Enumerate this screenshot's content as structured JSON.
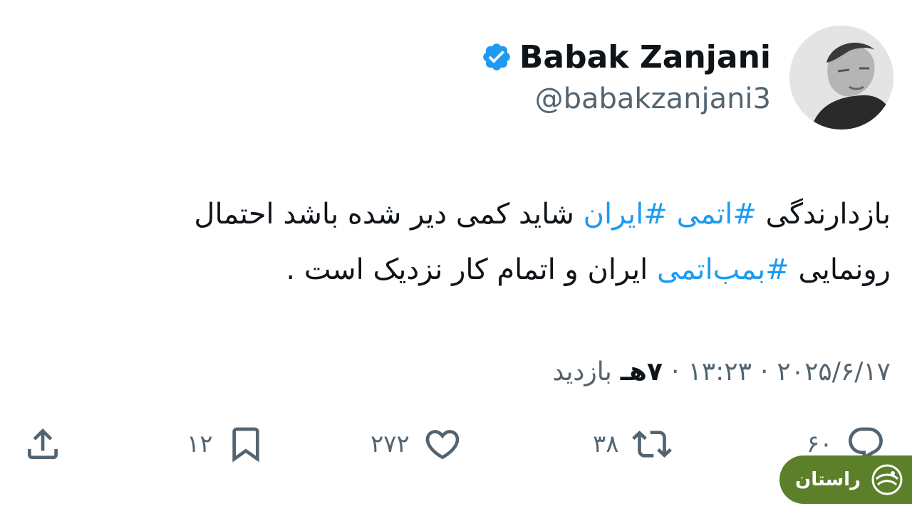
{
  "profile": {
    "display_name": "Babak Zanjani",
    "handle": "@babakzanjani3",
    "verified": true,
    "avatar_icon": "profile-photo"
  },
  "tweet": {
    "line1_part1": "بازدارندگی ",
    "hashtag_1": "#اتمی",
    "line1_part2": " ",
    "hashtag_2": "#ایران",
    "line1_part3": " شاید کمی دیر شده باشد احتمال",
    "line2_part1": "رونمایی ",
    "hashtag_3": "#بمب‌اتمی",
    "line2_part2": " ایران و اتمام کار نزدیک است ."
  },
  "meta": {
    "date": "۲۰۲۵/۶/۱۷",
    "separator_1": "·",
    "time": "۱۳:۲۳",
    "separator_2": "·",
    "views_count": "۷هـ",
    "views_label": "بازدید"
  },
  "actions": {
    "reply_count": "۶۰",
    "retweet_count": "۳۸",
    "like_count": "۲۷۲",
    "bookmark_count": "۱۲",
    "icons": [
      "reply-icon",
      "retweet-icon",
      "like-icon",
      "bookmark-icon",
      "share-icon"
    ]
  },
  "watermark": {
    "text": "راستان",
    "color": "#5c7f2a"
  },
  "colors": {
    "accent": "#1d9bf0",
    "text": "#0f1419",
    "muted": "#536471"
  }
}
